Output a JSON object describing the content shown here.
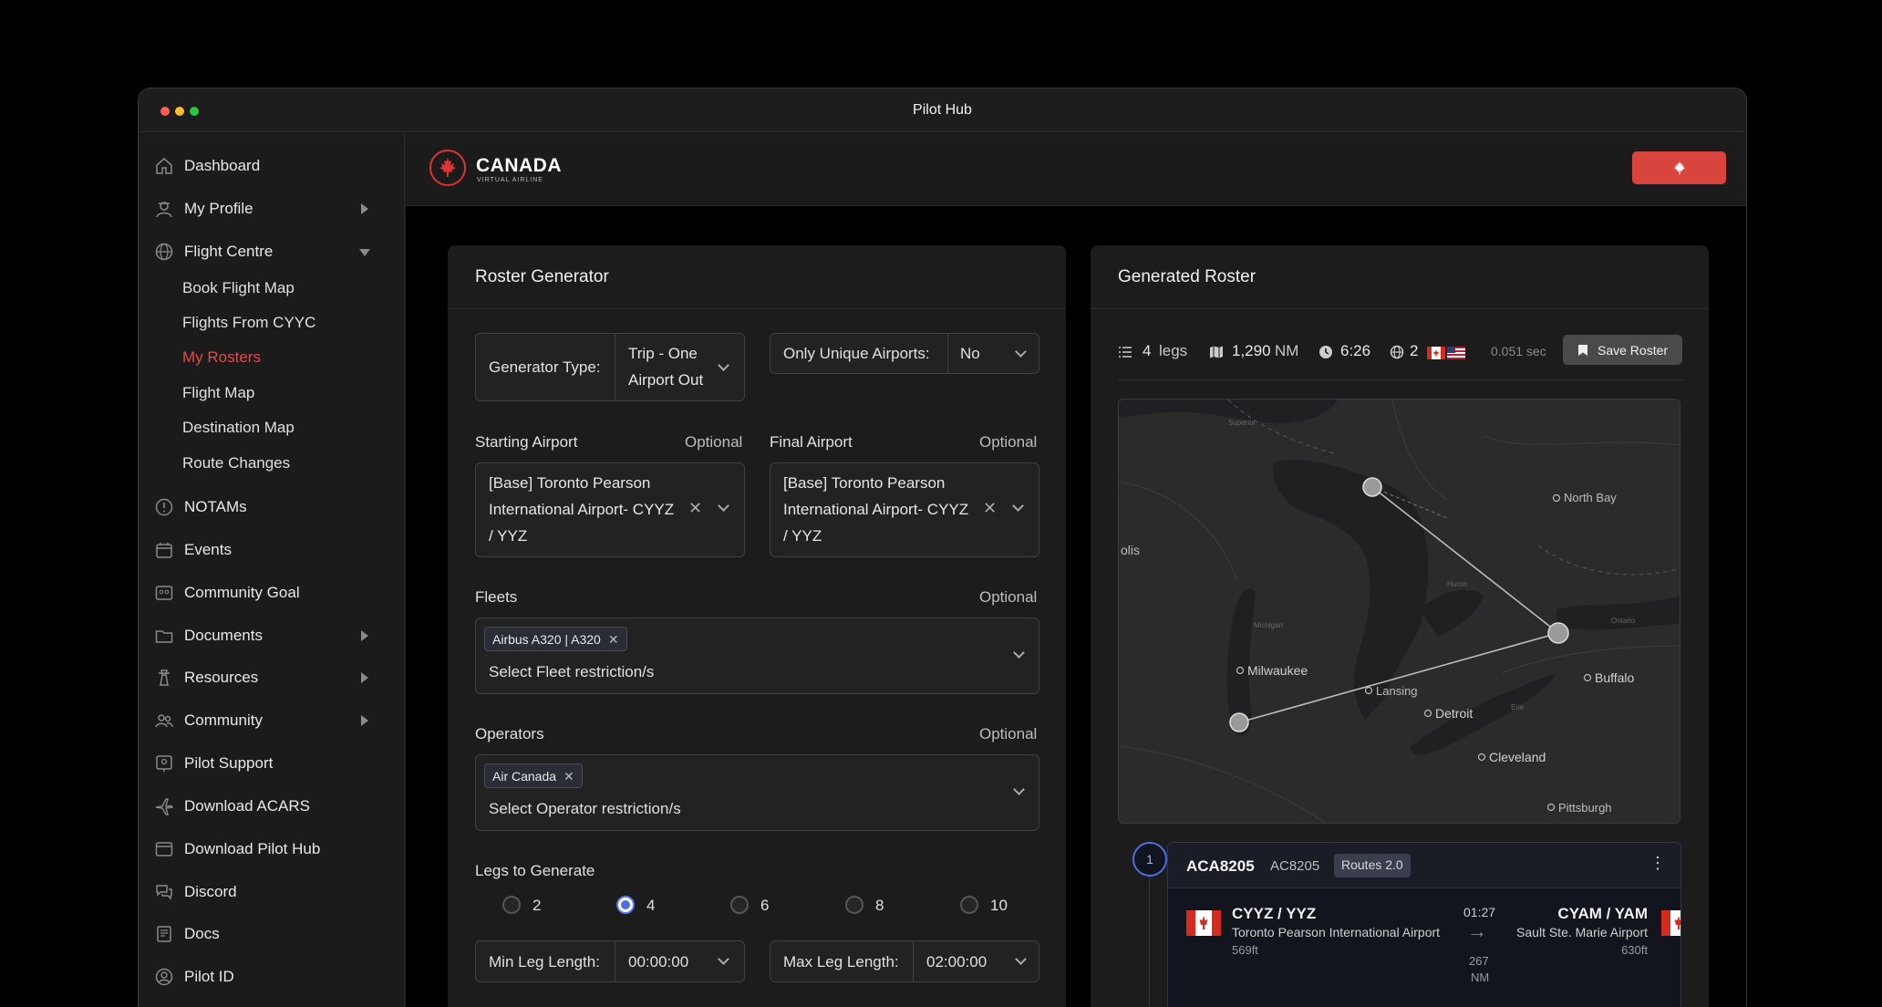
{
  "window": {
    "title": "Pilot Hub"
  },
  "sidebar": {
    "items": [
      {
        "label": "Dashboard"
      },
      {
        "label": "My Profile"
      },
      {
        "label": "Flight Centre"
      },
      {
        "label": "NOTAMs"
      },
      {
        "label": "Events"
      },
      {
        "label": "Community Goal"
      },
      {
        "label": "Documents"
      },
      {
        "label": "Resources"
      },
      {
        "label": "Community"
      },
      {
        "label": "Pilot Support"
      },
      {
        "label": "Download ACARS"
      },
      {
        "label": "Download Pilot Hub"
      },
      {
        "label": "Discord"
      },
      {
        "label": "Docs"
      },
      {
        "label": "Pilot ID"
      }
    ],
    "flight_centre_sub": [
      {
        "label": "Book Flight Map"
      },
      {
        "label": "Flights From CYYC"
      },
      {
        "label": "My Rosters"
      },
      {
        "label": "Flight Map"
      },
      {
        "label": "Destination Map"
      },
      {
        "label": "Route Changes"
      }
    ]
  },
  "header": {
    "brand": "CANADA",
    "brand_sub": "VIRTUAL AIRLINE"
  },
  "generator": {
    "title": "Roster Generator",
    "type_label": "Generator Type:",
    "type_value_1": "Trip - One",
    "type_value_2": "Airport Out",
    "unique_label": "Only Unique Airports:",
    "unique_value": "No",
    "optional": "Optional",
    "start_label": "Starting Airport",
    "start_l1": "[Base] Toronto Pearson",
    "start_l2": "International Airport- CYYZ",
    "start_l3": "/ YYZ",
    "final_label": "Final Airport",
    "final_l1": "[Base] Toronto Pearson",
    "final_l2": "International Airport- CYYZ",
    "final_l3": "/ YYZ",
    "fleets_label": "Fleets",
    "fleet_tag": "Airbus A320 | A320",
    "fleet_placeholder": "Select Fleet restriction/s",
    "operators_label": "Operators",
    "operator_tag": "Air Canada",
    "operator_placeholder": "Select Operator restriction/s",
    "legs_label": "Legs to Generate",
    "legs_options": [
      "2",
      "4",
      "6",
      "8",
      "10"
    ],
    "legs_selected": "4",
    "min_label": "Min Leg Length:",
    "min_value": "00:00:00",
    "max_label": "Max Leg Length:",
    "max_value": "02:00:00"
  },
  "roster": {
    "title": "Generated Roster",
    "legs_num": "4",
    "legs_unit": "legs",
    "dist_num": "1,290",
    "dist_unit": "NM",
    "time": "6:26",
    "countries": "2",
    "elapsed": "0.051 sec",
    "save_label": "Save Roster",
    "map_labels": [
      "Superior",
      "North Bay",
      "olis",
      "Milwaukee",
      "Lansing",
      "Buffalo",
      "Detroit",
      "Cleveland",
      "Pittsburgh",
      "Michigan",
      "Huron",
      "Ontario",
      "Erie"
    ],
    "leg": {
      "index": "1",
      "flight": "ACA8205",
      "callsign": "AC8205",
      "badge": "Routes 2.0",
      "dep_code": "CYYZ / YYZ",
      "dep_name": "Toronto Pearson International Airport",
      "dep_elev": "569ft",
      "duration": "01:27",
      "dist_num": "267",
      "dist_unit": "NM",
      "arr_code": "CYAM / YAM",
      "arr_name": "Sault Ste. Marie Airport",
      "arr_elev": "630ft"
    }
  },
  "colors": {
    "accent": "#d9443f",
    "active_nav": "#e04a4a",
    "radio": "#4d6fe0"
  }
}
